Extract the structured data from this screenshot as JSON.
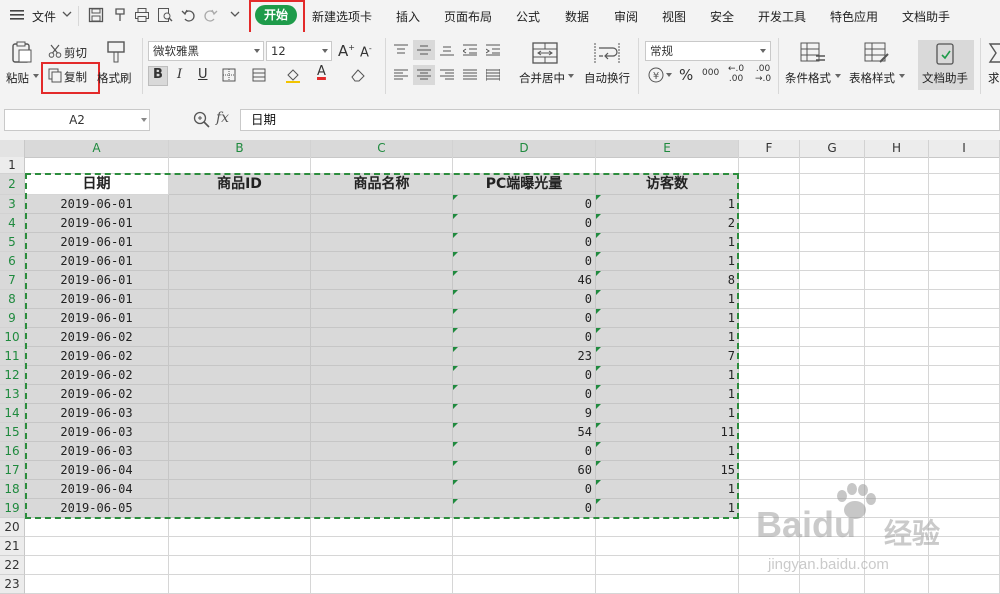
{
  "menubar": {
    "items": [
      "文件",
      "开始",
      "新建选项卡",
      "插入",
      "页面布局",
      "公式",
      "数据",
      "审阅",
      "视图",
      "安全",
      "开发工具",
      "特色应用",
      "文档助手"
    ]
  },
  "ribbon": {
    "paste": "粘贴",
    "cut": "剪切",
    "copy": "复制",
    "format_painter": "格式刷",
    "font_name": "微软雅黑",
    "font_size": "12",
    "bold": "B",
    "italic": "I",
    "underline": "U",
    "merge_center": "合并居中",
    "wrap_text": "自动换行",
    "number_format": "常规",
    "conditional_format": "条件格式",
    "table_style": "表格样式",
    "doc_assistant": "文档助手",
    "percent": "%",
    "thousands": "000",
    "dec_inc": ".0\n.00",
    "dec_dec": ".00\n.0",
    "truncated": "求"
  },
  "formula_bar": {
    "cell_ref": "A2",
    "fx": "fx",
    "content": "日期"
  },
  "columns": [
    "A",
    "B",
    "C",
    "D",
    "E",
    "F",
    "G",
    "H",
    "I"
  ],
  "rows": [
    "1",
    "2",
    "3",
    "4",
    "5",
    "6",
    "7",
    "8",
    "9",
    "10",
    "11",
    "12",
    "13",
    "14",
    "15",
    "16",
    "17",
    "18",
    "19",
    "20",
    "21",
    "22",
    "23"
  ],
  "table": {
    "headers": [
      "日期",
      "商品ID",
      "商品名称",
      "PC端曝光量",
      "访客数"
    ],
    "data": [
      [
        "2019-06-01",
        "",
        "",
        "0",
        "1"
      ],
      [
        "2019-06-01",
        "",
        "",
        "0",
        "2"
      ],
      [
        "2019-06-01",
        "",
        "",
        "0",
        "1"
      ],
      [
        "2019-06-01",
        "",
        "",
        "0",
        "1"
      ],
      [
        "2019-06-01",
        "",
        "",
        "46",
        "8"
      ],
      [
        "2019-06-01",
        "",
        "",
        "0",
        "1"
      ],
      [
        "2019-06-01",
        "",
        "",
        "0",
        "1"
      ],
      [
        "2019-06-02",
        "",
        "",
        "0",
        "1"
      ],
      [
        "2019-06-02",
        "",
        "",
        "23",
        "7"
      ],
      [
        "2019-06-02",
        "",
        "",
        "0",
        "1"
      ],
      [
        "2019-06-02",
        "",
        "",
        "0",
        "1"
      ],
      [
        "2019-06-03",
        "",
        "",
        "9",
        "1"
      ],
      [
        "2019-06-03",
        "",
        "",
        "54",
        "11"
      ],
      [
        "2019-06-03",
        "",
        "",
        "0",
        "1"
      ],
      [
        "2019-06-04",
        "",
        "",
        "60",
        "15"
      ],
      [
        "2019-06-04",
        "",
        "",
        "0",
        "1"
      ],
      [
        "2019-06-05",
        "",
        "",
        "0",
        "1"
      ]
    ]
  },
  "watermark": {
    "brand": "Baidu",
    "brand_cn": "经验",
    "url": "jingyan.baidu.com"
  },
  "colors": {
    "accent_green": "#1e9b4a",
    "highlight_red": "#e32a2a",
    "selection_gray": "#d9d9d9"
  }
}
